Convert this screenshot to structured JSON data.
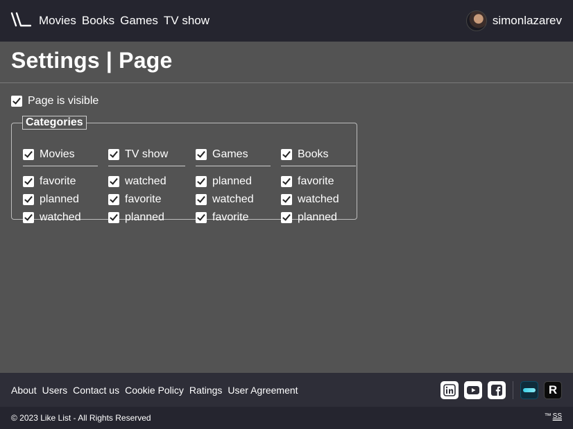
{
  "header": {
    "nav": [
      "Movies",
      "Books",
      "Games",
      "TV show"
    ],
    "username": "simonlazarev"
  },
  "page": {
    "title": "Settings | Page",
    "visible_label": "Page is visible",
    "visible_checked": true
  },
  "categories": {
    "legend": "Categories",
    "columns": [
      {
        "label": "Movies",
        "items": [
          "favorite",
          "planned",
          "watched"
        ]
      },
      {
        "label": "TV show",
        "items": [
          "watched",
          "favorite",
          "planned"
        ]
      },
      {
        "label": "Games",
        "items": [
          "planned",
          "watched",
          "favorite"
        ]
      },
      {
        "label": "Books",
        "items": [
          "favorite",
          "watched",
          "planned"
        ]
      }
    ]
  },
  "footer": {
    "links": [
      "About",
      "Users",
      "Contact us",
      "Cookie Policy",
      "Ratings",
      "User Agreement"
    ],
    "social": [
      "linkedin-icon",
      "youtube-icon",
      "facebook-icon",
      "tv-service-icon",
      "r-service-icon"
    ],
    "copyright": "© 2023 Like List - All Rights Reserved",
    "tm": "™",
    "tm_mark": "SS"
  }
}
